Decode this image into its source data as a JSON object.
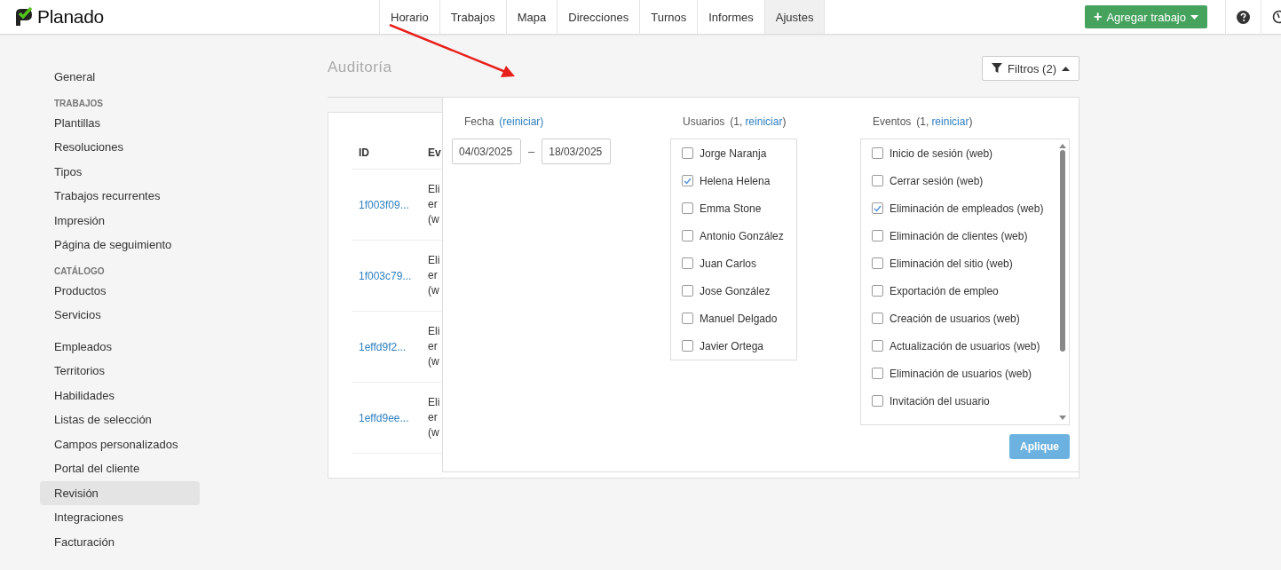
{
  "app": {
    "logo": "Planado"
  },
  "nav": {
    "tabs": [
      {
        "label": "Horario",
        "selected": false
      },
      {
        "label": "Trabajos",
        "selected": false
      },
      {
        "label": "Mapa",
        "selected": false
      },
      {
        "label": "Direcciones",
        "selected": false
      },
      {
        "label": "Turnos",
        "selected": false
      },
      {
        "label": "Informes",
        "selected": false
      },
      {
        "label": "Ajustes",
        "selected": true
      }
    ],
    "add_button": {
      "icon": "+",
      "label": "Agregar trabajo"
    }
  },
  "sidebar": {
    "groups": [
      {
        "items": [
          {
            "label": "General",
            "selected": false
          }
        ]
      },
      {
        "heading": "TRABAJOS",
        "items": [
          {
            "label": "Plantillas",
            "selected": false
          },
          {
            "label": "Resoluciones",
            "selected": false
          },
          {
            "label": "Tipos",
            "selected": false
          },
          {
            "label": "Trabajos recurrentes",
            "selected": false
          },
          {
            "label": "Impresión",
            "selected": false
          },
          {
            "label": "Página de seguimiento",
            "selected": false
          }
        ]
      },
      {
        "heading": "CATÁLOGO",
        "items": [
          {
            "label": "Productos",
            "selected": false
          },
          {
            "label": "Servicios",
            "selected": false
          }
        ]
      },
      {
        "items": [
          {
            "label": "Empleados",
            "selected": false
          },
          {
            "label": "Territorios",
            "selected": false
          },
          {
            "label": "Habilidades",
            "selected": false
          },
          {
            "label": "Listas de selección",
            "selected": false
          },
          {
            "label": "Campos personalizados",
            "selected": false
          },
          {
            "label": "Portal del cliente",
            "selected": false
          },
          {
            "label": "Revisión",
            "selected": true
          },
          {
            "label": "Integraciones",
            "selected": false
          },
          {
            "label": "Facturación",
            "selected": false
          }
        ]
      }
    ]
  },
  "page": {
    "title": "Auditoría",
    "filters_button": "Filtros (2)"
  },
  "table": {
    "columns": [
      "ID",
      "Ev"
    ],
    "rows": [
      {
        "id": "1f003f09...",
        "event": "Eli\ner\n(w"
      },
      {
        "id": "1f003c79...",
        "event": "Eli\ner\n(w"
      },
      {
        "id": "1effd9f2...",
        "event": "Eli\ner\n(w"
      },
      {
        "id": "1effd9ee...",
        "event": "Eli\ner\n(w"
      }
    ]
  },
  "filters": {
    "date": {
      "label": "Fecha",
      "reset": "(reiniciar)",
      "from": "04/03/2025",
      "separator": "–",
      "to": "18/03/2025"
    },
    "users": {
      "label": "Usuarios",
      "reset_prefix": "(1,",
      "reset": "reiniciar",
      "reset_suffix": ")",
      "options": [
        {
          "label": "Jorge Naranja",
          "checked": false
        },
        {
          "label": "Helena Helena",
          "checked": true
        },
        {
          "label": "Emma Stone",
          "checked": false
        },
        {
          "label": "Antonio González",
          "checked": false
        },
        {
          "label": "Juan Carlos",
          "checked": false
        },
        {
          "label": "Jose González",
          "checked": false
        },
        {
          "label": "Manuel Delgado",
          "checked": false
        },
        {
          "label": "Javier Ortega",
          "checked": false
        }
      ]
    },
    "events": {
      "label": "Eventos",
      "reset_prefix": "(1,",
      "reset": "reiniciar",
      "reset_suffix": ")",
      "options": [
        {
          "label": "Inicio de sesión (web)",
          "checked": false
        },
        {
          "label": "Cerrar sesión (web)",
          "checked": false
        },
        {
          "label": "Eliminación de empleados (web)",
          "checked": true
        },
        {
          "label": "Eliminación de clientes (web)",
          "checked": false
        },
        {
          "label": "Eliminación del sitio (web)",
          "checked": false
        },
        {
          "label": "Exportación de empleo",
          "checked": false
        },
        {
          "label": "Creación de usuarios (web)",
          "checked": false
        },
        {
          "label": "Actualización de usuarios (web)",
          "checked": false
        },
        {
          "label": "Eliminación de usuarios (web)",
          "checked": false
        },
        {
          "label": "Invitación del usuario",
          "checked": false
        }
      ]
    },
    "apply_button": {
      "label": "Aplique",
      "disabled": true
    }
  }
}
